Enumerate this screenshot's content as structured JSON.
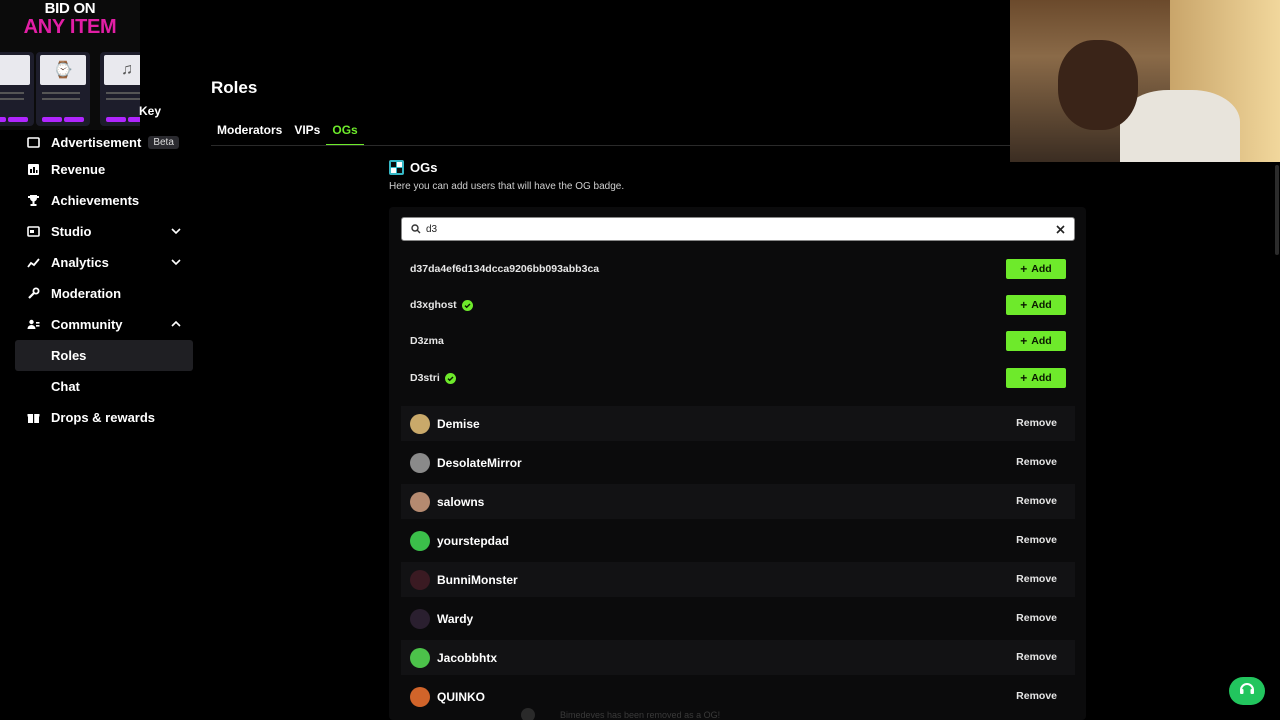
{
  "ad": {
    "line1": "BID ON",
    "line2": "ANY ITEM",
    "key_label": "Key"
  },
  "sidebar": {
    "items": [
      {
        "label": "Advertisement",
        "badge": "Beta",
        "icon": "advertisement-icon"
      },
      {
        "label": "Revenue",
        "icon": "revenue-icon"
      },
      {
        "label": "Achievements",
        "icon": "trophy-icon"
      },
      {
        "label": "Studio",
        "icon": "studio-icon",
        "expandable": true
      },
      {
        "label": "Analytics",
        "icon": "analytics-icon",
        "expandable": true
      },
      {
        "label": "Moderation",
        "icon": "wrench-icon"
      },
      {
        "label": "Community",
        "icon": "community-icon",
        "expanded": true
      },
      {
        "label": "Roles",
        "sub": true,
        "active": true
      },
      {
        "label": "Chat",
        "sub": true
      },
      {
        "label": "Drops & rewards",
        "icon": "drops-icon"
      }
    ]
  },
  "page": {
    "title": "Roles",
    "tabs": [
      {
        "label": "Moderators"
      },
      {
        "label": "VIPs"
      },
      {
        "label": "OGs",
        "active": true
      }
    ]
  },
  "section": {
    "title": "OGs",
    "description": "Here you can add users that will have the OG badge."
  },
  "search": {
    "value": "d3",
    "placeholder": ""
  },
  "results": [
    {
      "name": "d37da4ef6d134dcca9206bb093abb3ca",
      "verified": false,
      "action": "Add"
    },
    {
      "name": "d3xghost",
      "verified": true,
      "action": "Add"
    },
    {
      "name": "D3zma",
      "verified": false,
      "action": "Add"
    },
    {
      "name": "D3stri",
      "verified": true,
      "action": "Add"
    }
  ],
  "ogs": [
    {
      "name": "Demise",
      "action": "Remove",
      "avatar_color": "#c9a96a"
    },
    {
      "name": "DesolateMirror",
      "action": "Remove",
      "avatar_color": "#8a8a8a"
    },
    {
      "name": "salowns",
      "action": "Remove",
      "avatar_color": "#b58a70"
    },
    {
      "name": "yourstepdad",
      "action": "Remove",
      "avatar_color": "#3bbf4a"
    },
    {
      "name": "BunniMonster",
      "action": "Remove",
      "avatar_color": "#3a1a22"
    },
    {
      "name": "Wardy",
      "action": "Remove",
      "avatar_color": "#2a1f2f"
    },
    {
      "name": "Jacobbhtx",
      "action": "Remove",
      "avatar_color": "#4cc24a"
    },
    {
      "name": "QUINKO",
      "action": "Remove",
      "avatar_color": "#d1642a"
    }
  ],
  "toast": {
    "text": "Bimedeves has been removed as a OG!"
  },
  "colors": {
    "accent": "#6eea2b",
    "background": "#000000",
    "help": "#22c55e"
  }
}
